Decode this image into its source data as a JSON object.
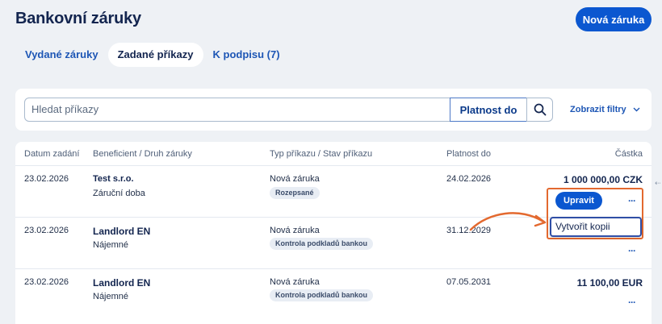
{
  "header": {
    "title": "Bankovní záruky",
    "new_button": "Nová záruka"
  },
  "tabs": [
    {
      "label": "Vydané záruky",
      "active": false
    },
    {
      "label": "Zadané příkazy",
      "active": true
    },
    {
      "label": "K podpisu (7)",
      "active": false
    }
  ],
  "search": {
    "placeholder": "Hledat příkazy",
    "validity_label": "Platnost do",
    "filters_label": "Zobrazit filtry"
  },
  "table": {
    "headers": [
      "Datum zadání",
      "Beneficient / Druh záruky",
      "Typ příkazu / Stav příkazu",
      "Platnost do",
      "Částka"
    ],
    "rows": [
      {
        "date": "23.02.2026",
        "beneficiary": "Test s.r.o.",
        "kind": "Záruční doba",
        "type": "Nová záruka",
        "status": "Rozepsané",
        "valid_to": "24.02.2026",
        "amount": "1 000 000,00 CZK"
      },
      {
        "date": "23.02.2026",
        "beneficiary": "Landlord EN",
        "kind": "Nájemné",
        "type": "Nová záruka",
        "status": "Kontrola podkladů bankou",
        "valid_to": "31.12.2029",
        "amount": ""
      },
      {
        "date": "23.02.2026",
        "beneficiary": "Landlord EN",
        "kind": "Nájemné",
        "type": "Nová záruka",
        "status": "Kontrola podkladů bankou",
        "valid_to": "07.05.2031",
        "amount": "11 100,00 EUR"
      }
    ]
  },
  "actions": {
    "edit_label": "Upravit",
    "more_label": "···",
    "copy_label": "Vytvořit kopii"
  },
  "colors": {
    "primary": "#0b57d0",
    "annotation": "#e3692f"
  }
}
